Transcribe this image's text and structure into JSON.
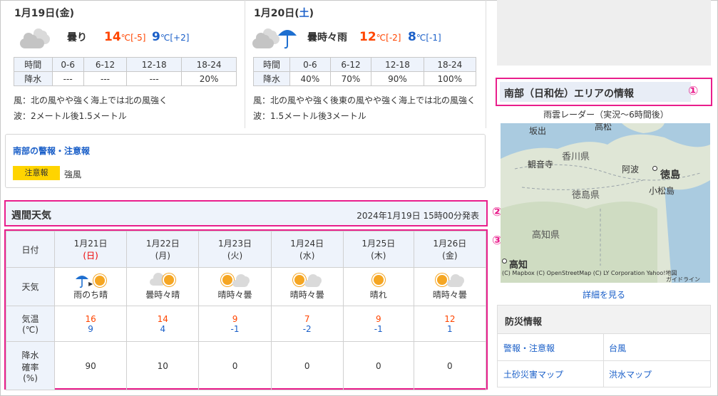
{
  "today": {
    "date": "1月19日",
    "dow_open": "(",
    "dow": "金",
    "dow_close": ")",
    "condition": "曇り",
    "tmax": "14",
    "tmax_unit": "℃",
    "tmax_diff": "[-5]",
    "tmin": "9",
    "tmin_unit": "℃",
    "tmin_diff": "[+2]",
    "rain_header": [
      "時間",
      "0-6",
      "6-12",
      "12-18",
      "18-24"
    ],
    "rain_row": [
      "降水",
      "---",
      "---",
      "---",
      "20%"
    ],
    "wind": "風：北の風やや強く海上では北の風強く",
    "wave": "波：2メートル後1.5メートル"
  },
  "tomorrow": {
    "date": "1月20日",
    "dow_open": "(",
    "dow": "土",
    "dow_close": ")",
    "condition": "曇時々雨",
    "tmax": "12",
    "tmax_unit": "℃",
    "tmax_diff": "[-2]",
    "tmin": "8",
    "tmin_unit": "℃",
    "tmin_diff": "[-1]",
    "rain_header": [
      "時間",
      "0-6",
      "6-12",
      "12-18",
      "18-24"
    ],
    "rain_row": [
      "降水",
      "40%",
      "70%",
      "90%",
      "100%"
    ],
    "wind": "風：北の風やや強く後東の風やや強く海上では北の風強く",
    "wave": "波：1.5メートル後3メートル"
  },
  "warnings": {
    "title": "南部の警報・注意報",
    "badge": "注意報",
    "text": "強風",
    "badge_color": "#ffd400"
  },
  "weekly": {
    "title": "週間天気",
    "issued": "2024年1月19日 15時00分発表",
    "row_labels": {
      "date": "日付",
      "weather": "天気",
      "temp_1": "気温",
      "temp_2": "(℃)",
      "pop_1": "降水",
      "pop_2": "確率",
      "pop_3": "(%)"
    },
    "days": [
      {
        "date": "1月21日",
        "dow": "(日)",
        "weather": "雨のち晴",
        "icon": "rain-then-sun-icon",
        "hi": "16",
        "lo": "9",
        "pop": "90"
      },
      {
        "date": "1月22日",
        "dow": "(月)",
        "weather": "曇時々晴",
        "icon": "cloud-sun-icon",
        "hi": "14",
        "lo": "4",
        "pop": "10"
      },
      {
        "date": "1月23日",
        "dow": "(火)",
        "weather": "晴時々曇",
        "icon": "sun-cloud-icon",
        "hi": "9",
        "lo": "-1",
        "pop": "0"
      },
      {
        "date": "1月24日",
        "dow": "(水)",
        "weather": "晴時々曇",
        "icon": "sun-cloud-icon",
        "hi": "7",
        "lo": "-2",
        "pop": "0"
      },
      {
        "date": "1月25日",
        "dow": "(木)",
        "weather": "晴れ",
        "icon": "sun-icon",
        "hi": "9",
        "lo": "-1",
        "pop": "0"
      },
      {
        "date": "1月26日",
        "dow": "(金)",
        "weather": "晴時々曇",
        "icon": "sun-cloud-icon",
        "hi": "12",
        "lo": "1",
        "pop": "0"
      }
    ]
  },
  "area": {
    "title": "南部（日和佐）エリアの情報",
    "radar_label": "雨雲レーダー（実況〜6時間後）",
    "map_labels": {
      "sakaide": "坂出",
      "takamatsu": "高松",
      "kagawa": "香川県",
      "kanonji": "観音寺",
      "awa": "阿波",
      "tokushima": "徳島",
      "komatsushima": "小松島",
      "tokushima_pref": "徳島県",
      "kochi_pref": "高知県",
      "kochi": "高知"
    },
    "map_credit": "(C) Mapbox (C) OpenStreetMap (C) LY Corporation Yahoo!地図",
    "map_guide": "ガイドライン",
    "detail_link": "詳細を見る"
  },
  "bosai": {
    "title": "防災情報",
    "links": [
      "警報・注意報",
      "台風",
      "土砂災害マップ",
      "洪水マップ"
    ]
  },
  "markers": [
    "①",
    "②",
    "③"
  ],
  "colors": {
    "accent": "#e91e8c",
    "link": "#1a5fc8",
    "high_temp": "#ff4500",
    "low_temp": "#1a5fc8"
  }
}
